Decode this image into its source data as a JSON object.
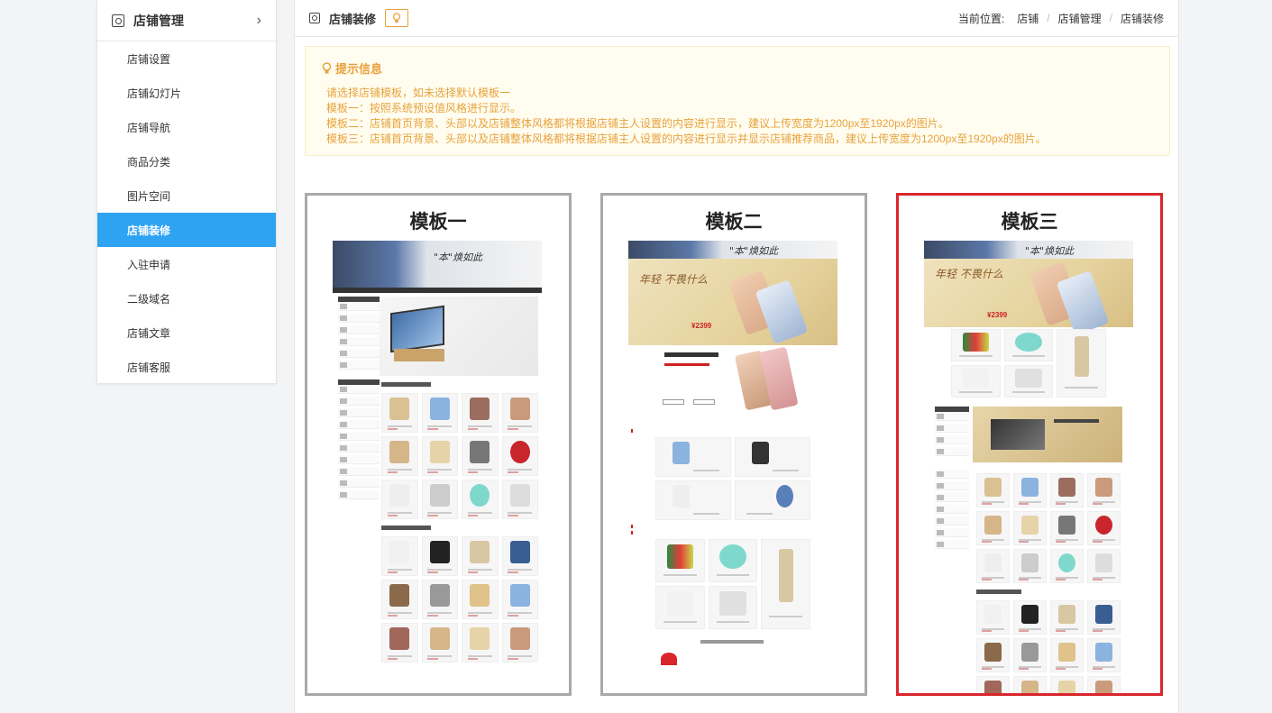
{
  "sidebar": {
    "title": "店铺管理",
    "items": [
      {
        "label": "店铺设置",
        "active": false
      },
      {
        "label": "店铺幻灯片",
        "active": false
      },
      {
        "label": "店铺导航",
        "active": false
      },
      {
        "label": "商品分类",
        "active": false
      },
      {
        "label": "图片空间",
        "active": false
      },
      {
        "label": "店铺装修",
        "active": true
      },
      {
        "label": "入驻申请",
        "active": false
      },
      {
        "label": "二级域名",
        "active": false
      },
      {
        "label": "店铺文章",
        "active": false
      },
      {
        "label": "店铺客服",
        "active": false
      }
    ]
  },
  "header": {
    "title": "店铺装修",
    "breadcrumb_label": "当前位置:",
    "breadcrumb": [
      "店铺",
      "店铺管理",
      "店铺装修"
    ]
  },
  "notice": {
    "title": "提示信息",
    "lines": [
      "请选择店铺模板，如未选择默认模板一",
      "模板一：按照系统预设值风格进行显示。",
      "模板二：店铺首页背景、头部以及店铺整体风格都将根据店铺主人设置的内容进行显示，建议上传宽度为1200px至1920px的图片。",
      "模板三：店铺首页背景、头部以及店铺整体风格都将根据店铺主人设置的内容进行显示并显示店铺推荐商品，建议上传宽度为1200px至1920px的图片。"
    ]
  },
  "templates": [
    {
      "name": "模板一",
      "selected": false
    },
    {
      "name": "模板二",
      "selected": false
    },
    {
      "name": "模板三",
      "selected": true
    }
  ],
  "colors": {
    "accent": "#2ea3f2",
    "notice_text": "#e8a23c",
    "selected_border": "#d9262c",
    "default_border": "#a9a9a9"
  }
}
